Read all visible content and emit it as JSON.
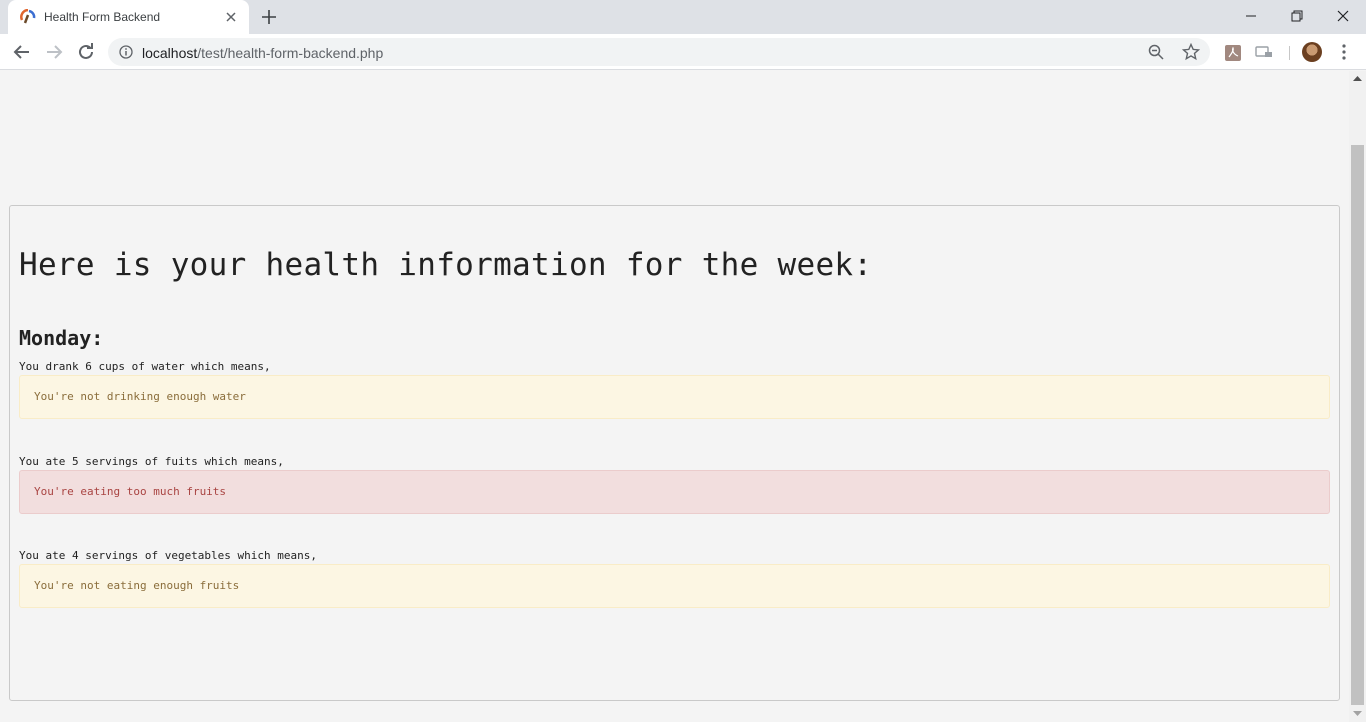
{
  "browser": {
    "tab_title": "Health Form Backend",
    "url_host": "localhost",
    "url_path": "/test/health-form-backend.php"
  },
  "page": {
    "heading": "Here is your health information for the week:",
    "day": "Monday:",
    "entries": [
      {
        "stat": "You drank 6 cups of water which means,",
        "message": "You're not drinking enough water",
        "level": "warning"
      },
      {
        "stat": "You ate 5 servings of fuits which means,",
        "message": "You're eating too much fruits",
        "level": "danger"
      },
      {
        "stat": "You ate 4 servings of vegetables which means,",
        "message": "You're not eating enough fruits",
        "level": "warning"
      }
    ]
  },
  "colors": {
    "warning_bg": "#fcf6e3",
    "warning_text": "#8a6d3b",
    "danger_bg": "#f2dede",
    "danger_text": "#a94442"
  }
}
